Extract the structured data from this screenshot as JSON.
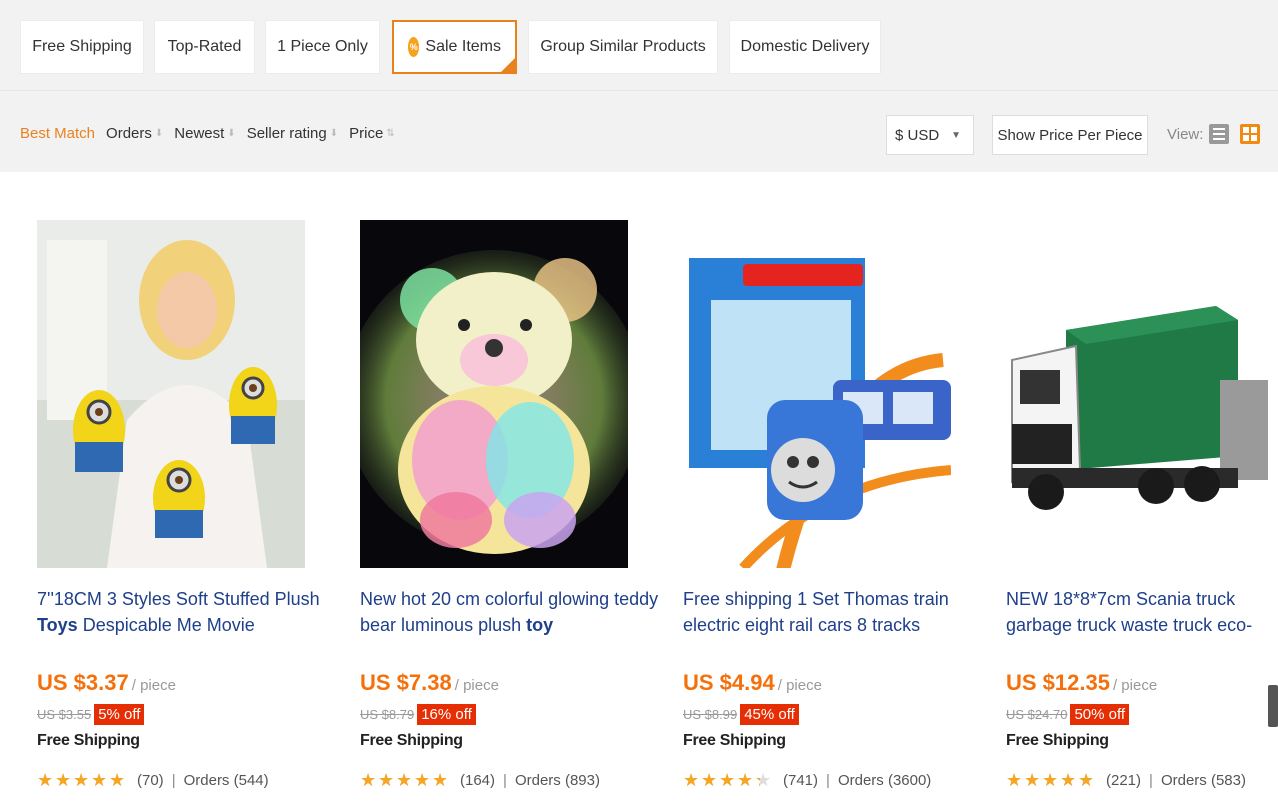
{
  "filters": [
    {
      "label": "Free Shipping",
      "active": false
    },
    {
      "label": "Top-Rated",
      "active": false
    },
    {
      "label": "1 Piece Only",
      "active": false
    },
    {
      "label": "Sale Items",
      "active": true,
      "icon": "sale-tag-icon",
      "icon_text": "%"
    },
    {
      "label": "Group Similar Products",
      "active": false
    },
    {
      "label": "Domestic Delivery",
      "active": false
    }
  ],
  "sort": {
    "items": [
      {
        "label": "Best Match",
        "active": true
      },
      {
        "label": "Orders",
        "arrow": "⬇"
      },
      {
        "label": "Newest",
        "arrow": "⬇"
      },
      {
        "label": "Seller rating",
        "arrow": "⬇"
      },
      {
        "label": "Price",
        "arrow": "⇅"
      }
    ],
    "currency": "$ USD",
    "currency_caret": "▼",
    "price_per_piece": "Show Price Per Piece",
    "view_label": "View:"
  },
  "colors": {
    "accent": "#e8821f",
    "price": "#f5700b",
    "discount_bg": "#e62e04",
    "title_link": "#1e3f8a",
    "star": "#f5a623"
  },
  "products": [
    {
      "title_pre": "7''18CM 3 Styles Soft Stuffed Plush ",
      "title_bold": "Toys",
      "title_post": " Despicable Me Movie",
      "price": "US $3.37",
      "unit": "/ piece",
      "original_price": "US $3.55",
      "discount": "5% off",
      "shipping": "Free Shipping",
      "rating": 5,
      "rating_count": "(70)",
      "separator": "|",
      "orders": "Orders (544)"
    },
    {
      "title_pre": "New hot 20 cm colorful glowing teddy bear luminous plush ",
      "title_bold": "toy",
      "title_post": "",
      "price": "US $7.38",
      "unit": "/ piece",
      "original_price": "US $8.79",
      "discount": "16% off",
      "shipping": "Free Shipping",
      "rating": 4.8,
      "rating_count": "(164)",
      "separator": "|",
      "orders": "Orders (893)"
    },
    {
      "title_pre": "Free shipping 1 Set Thomas train electric eight rail cars 8 tracks",
      "title_bold": "",
      "title_post": "",
      "price": "US $4.94",
      "unit": "/ piece",
      "original_price": "US $8.99",
      "discount": "45% off",
      "shipping": "Free Shipping",
      "rating": 4.3,
      "rating_count": "(741)",
      "separator": "|",
      "orders": "Orders (3600)"
    },
    {
      "title_pre": "NEW 18*8*7cm Scania truck garbage truck waste truck eco-",
      "title_bold": "",
      "title_post": "",
      "price": "US $12.35",
      "unit": "/ piece",
      "original_price": "US $24.70",
      "discount": "50% off",
      "shipping": "Free Shipping",
      "rating": 4.8,
      "rating_count": "(221)",
      "separator": "|",
      "orders": "Orders (583)"
    }
  ]
}
